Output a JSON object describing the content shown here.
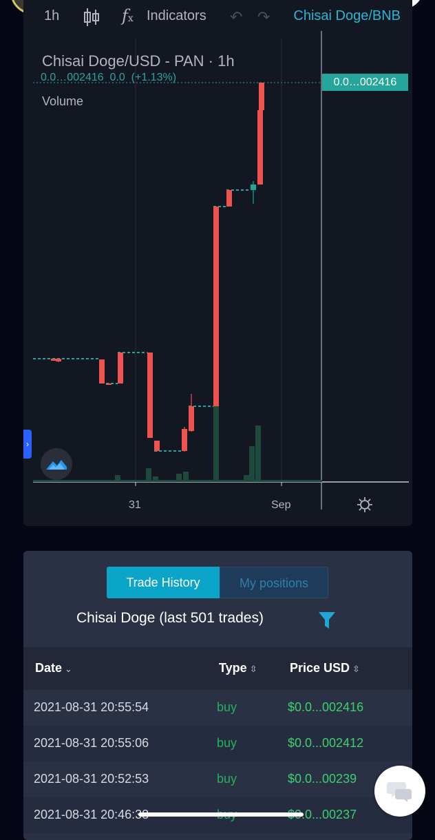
{
  "toolbar": {
    "interval": "1h",
    "indicators_label": "Indicators",
    "pair": "Chisai Doge/BNB",
    "icons": {
      "candles": "candlestick-icon",
      "fx": "fx-icon",
      "undo": "undo-icon",
      "redo": "redo-icon"
    }
  },
  "legend": {
    "title": "Chisai Doge/USD - PAN · 1h",
    "values": "0.0…002416  0.0  (+1.13%)",
    "volume_label": "Volume"
  },
  "price_tag": "0.0…002416",
  "x_labels": {
    "day31": "31",
    "sep": "Sep"
  },
  "colors": {
    "up": "#26a69a",
    "down": "#ef5350",
    "accent": "#29b6d6",
    "buy": "#3ccf6e"
  },
  "chart_data": {
    "type": "candlestick",
    "title": "Chisai Doge/USD - PAN · 1h",
    "x_ticks": [
      "31",
      "Sep"
    ],
    "last_price": "0.0…002416",
    "change": "(+1.13%)"
  },
  "trades": {
    "tabs": [
      "Trade History",
      "My positions"
    ],
    "title": "Chisai Doge (last 501 trades)",
    "columns": [
      "Date",
      "Type",
      "Price USD"
    ],
    "rows": [
      {
        "date": "2021-08-31 20:55:54",
        "type": "buy",
        "price": "$0.0...002416"
      },
      {
        "date": "2021-08-31 20:55:06",
        "type": "buy",
        "price": "$0.0...002412"
      },
      {
        "date": "2021-08-31 20:52:53",
        "type": "buy",
        "price": "$0.0...00239"
      },
      {
        "date": "2021-08-31 20:46:38",
        "type": "buy",
        "price": "$0.0...00237"
      }
    ]
  }
}
